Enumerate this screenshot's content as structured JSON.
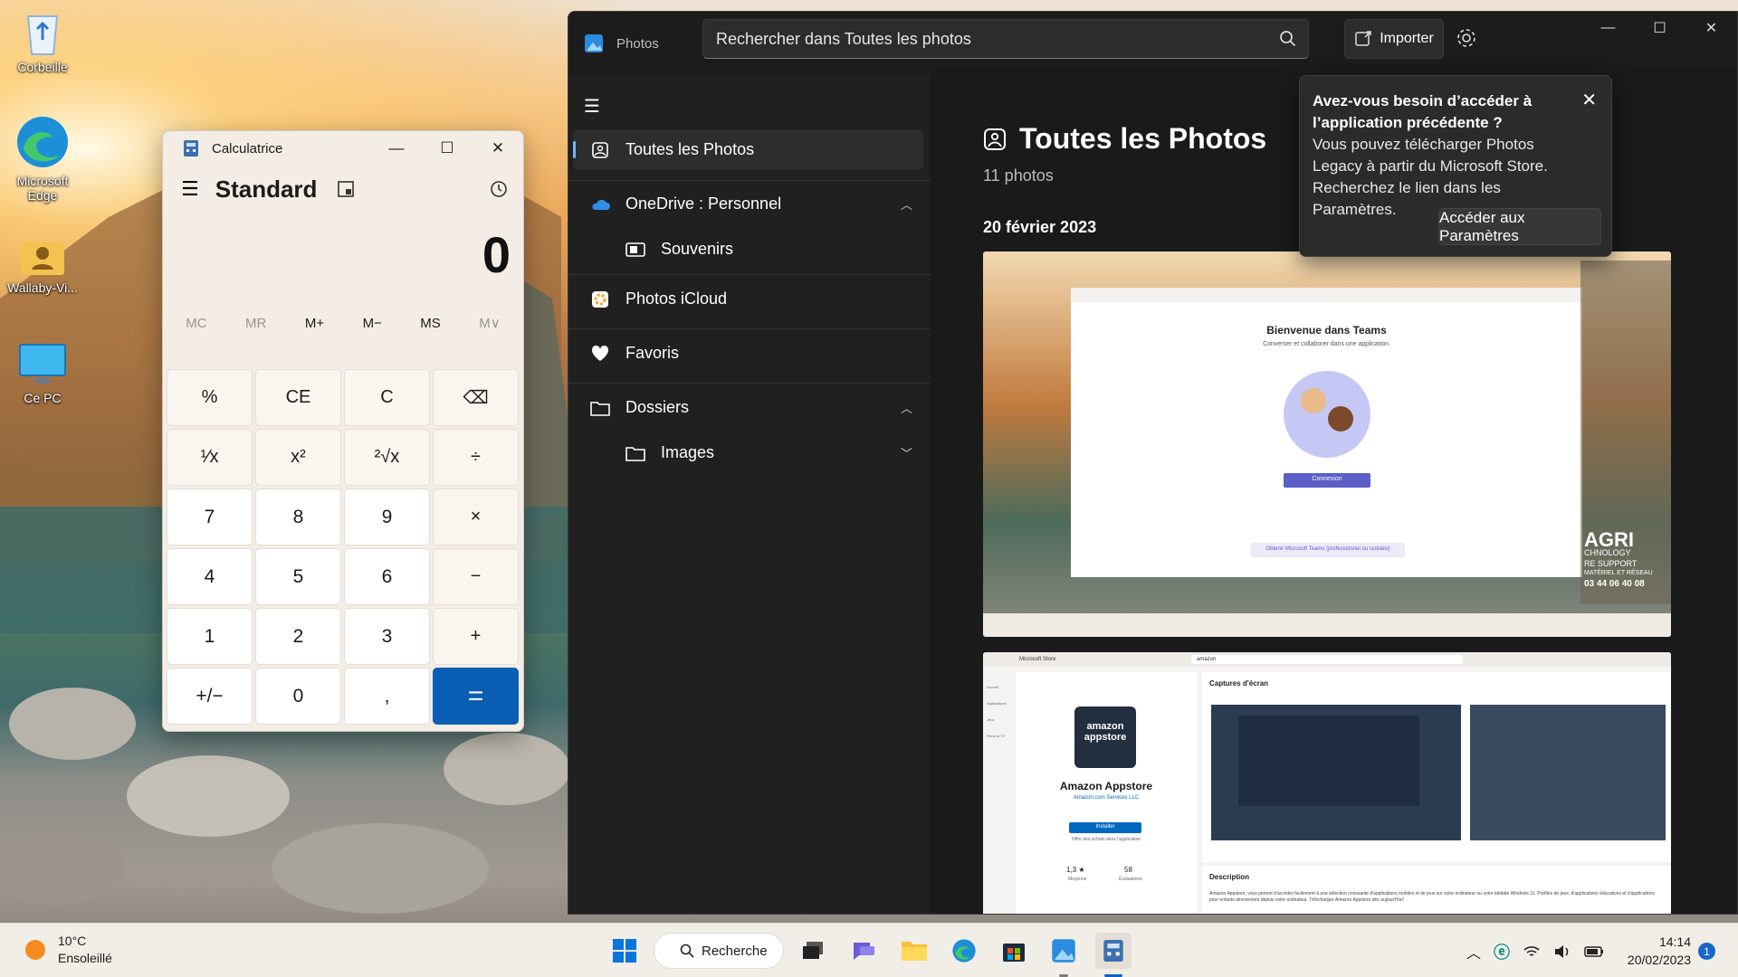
{
  "desktop": {
    "icons": [
      "Corbeille",
      "Microsoft Edge",
      "Wallaby-Vi...",
      "Ce PC"
    ]
  },
  "calculator": {
    "title": "Calculatrice",
    "mode": "Standard",
    "display": "0",
    "memory": [
      {
        "label": "MC",
        "enabled": false
      },
      {
        "label": "MR",
        "enabled": false
      },
      {
        "label": "M+",
        "enabled": true
      },
      {
        "label": "M−",
        "enabled": true
      },
      {
        "label": "MS",
        "enabled": true
      },
      {
        "label": "M∨",
        "enabled": false
      }
    ],
    "keys": [
      "%",
      "CE",
      "C",
      "⌫",
      "¹⁄x",
      "x²",
      "²√x",
      "÷",
      "7",
      "8",
      "9",
      "×",
      "4",
      "5",
      "6",
      "−",
      "1",
      "2",
      "3",
      "+",
      "+/−",
      "0",
      ",",
      "="
    ],
    "colors": {
      "equals": "#0a5fb4"
    }
  },
  "photos": {
    "app_name": "Photos",
    "search_placeholder": "Rechercher dans Toutes les photos",
    "import_label": "Importer",
    "nav": [
      {
        "label": "Toutes les Photos",
        "icon": "gallery-icon",
        "selected": true
      },
      {
        "label": "OneDrive : Personnel",
        "icon": "cloud-icon",
        "expanded": true
      },
      {
        "label": "Souvenirs",
        "icon": "memories-icon"
      },
      {
        "label": "Photos iCloud",
        "icon": "icloud-icon"
      },
      {
        "label": "Favoris",
        "icon": "heart-icon"
      },
      {
        "label": "Dossiers",
        "icon": "folder-icon",
        "expanded": true
      },
      {
        "label": "Images",
        "icon": "folder-icon",
        "expanded": false
      }
    ],
    "gallery": {
      "title": "Toutes les Photos",
      "count": "11 photos",
      "date": "20 février 2023",
      "shot1": {
        "title": "Bienvenue dans Teams",
        "subtitle": "Converser et collaborer dans une application.",
        "button": "Connexion",
        "link": "Obtenir Microsoft Teams (professionnel ou scolaire)",
        "ad_brand": "AGRI",
        "ad_sub": "CHNOLOGY",
        "ad_line1": "RE SUPPORT",
        "ad_line2": "MATÉRIEL ET RÉSEAU",
        "ad_phone": "03 44 06 40 08"
      },
      "shot2": {
        "store": "Microsoft Store",
        "search": "amazon",
        "logo_line1": "amazon",
        "logo_line2": "appstore",
        "name": "Amazon Appstore",
        "publisher": "Amazon.com Services LLC",
        "install": "Installer",
        "offer": "Offre des achats dans l'application",
        "rating": "1,3 ★",
        "rating_label": "Moyenne",
        "reviews": "58",
        "reviews_label": "Évaluations",
        "screens_title": "Captures d'écran",
        "desc_title": "Description",
        "desc": "Amazon Appstore, vous permet d'accéder facilement à une sélection croissante d'applications mobiles et de jeux sur votre ordinateur ou votre tablette Windows 11. Profitez de jeux, d'applications éducatives et d'applications pour enfants directement depuis votre ordinateur. Téléchargez Amazon Appstore dès aujourd'hui!",
        "nav1": "Accueil",
        "nav2": "Applications",
        "nav3": "Jeux",
        "nav4": "Films et TV"
      }
    },
    "tip": {
      "title": "Avez-vous besoin d’accéder à l’application précédente ?",
      "body": "Vous pouvez télécharger Photos Legacy à partir du Microsoft Store. Recherchez le lien dans les Paramètres.",
      "button": "Accéder aux Paramètres"
    },
    "colors": {
      "accent": "#6cb8f6"
    }
  },
  "taskbar": {
    "temp": "10°C",
    "weather": "Ensoleillé",
    "search": "Recherche",
    "time": "14:14",
    "date": "20/02/2023",
    "badge": "1"
  }
}
